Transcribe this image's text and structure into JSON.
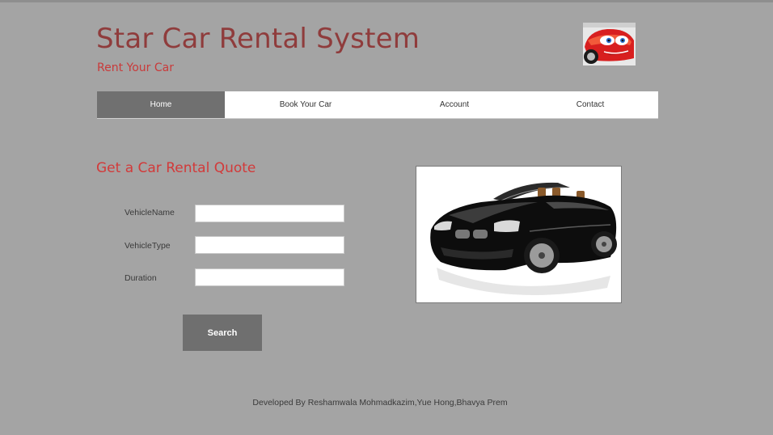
{
  "header": {
    "title": "Star Car Rental System",
    "subtitle": "Rent Your Car",
    "logo_icon": "cartoon-race-car-icon"
  },
  "nav": {
    "items": [
      {
        "label": "Home",
        "active": true
      },
      {
        "label": "Book Your Car",
        "active": false
      },
      {
        "label": "Account",
        "active": false
      },
      {
        "label": "Contact",
        "active": false
      }
    ]
  },
  "quote_form": {
    "title": "Get a Car Rental Quote",
    "fields": [
      {
        "label": "VehicleName",
        "value": "",
        "placeholder": ""
      },
      {
        "label": "VehicleType",
        "value": "",
        "placeholder": ""
      },
      {
        "label": "Duration",
        "value": "",
        "placeholder": ""
      }
    ],
    "search_label": "Search"
  },
  "car_image": {
    "icon": "black-convertible-car-photo"
  },
  "footer": {
    "text": "Developed By Reshamwala Mohmadkazim,Yue Hong,Bhavya Prem"
  },
  "colors": {
    "background": "#a4a4a4",
    "title": "#8f3c3c",
    "accent": "#d23a3a",
    "nav_active": "#707070",
    "button": "#6f6f6f"
  }
}
